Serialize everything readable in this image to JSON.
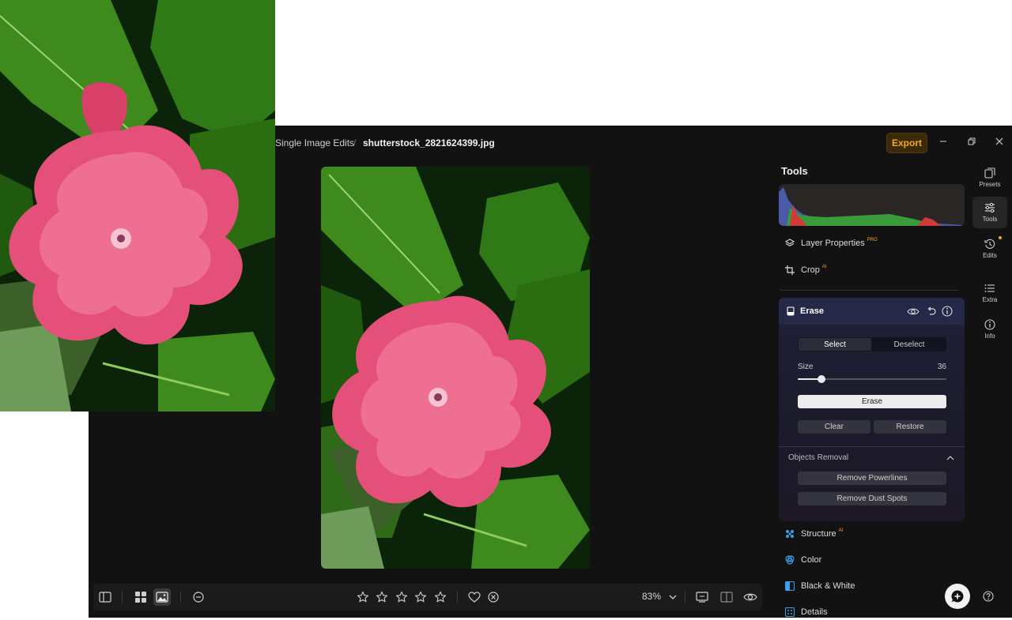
{
  "breadcrumb": {
    "root": "Single Image Edits",
    "separator": "/",
    "file": "shutterstock_2821624399.jpg"
  },
  "header": {
    "export_label": "Export"
  },
  "tools_panel": {
    "title": "Tools",
    "items": [
      {
        "label": "Layer Properties",
        "badge": "PRO",
        "icon": "layers-icon"
      },
      {
        "label": "Crop",
        "badge": "AI",
        "icon": "crop-icon"
      }
    ],
    "erase": {
      "title": "Erase",
      "select_label": "Select",
      "deselect_label": "Deselect",
      "size_label": "Size",
      "size_value": "36",
      "size_fraction": 0.16,
      "erase_label": "Erase",
      "clear_label": "Clear",
      "restore_label": "Restore",
      "objects_removal_title": "Objects Removal",
      "remove_powerlines_label": "Remove Powerlines",
      "remove_dust_label": "Remove Dust Spots"
    },
    "lower_items": [
      {
        "label": "Structure",
        "badge": "AI",
        "icon": "structure-icon"
      },
      {
        "label": "Color",
        "badge": "",
        "icon": "color-icon"
      },
      {
        "label": "Black & White",
        "badge": "",
        "icon": "black-white-icon"
      },
      {
        "label": "Details",
        "badge": "",
        "icon": "details-icon"
      }
    ]
  },
  "rail": [
    {
      "label": "Presets",
      "icon": "presets-icon"
    },
    {
      "label": "Tools",
      "icon": "sliders-icon"
    },
    {
      "label": "Edits",
      "icon": "history-icon"
    },
    {
      "label": "Extra",
      "icon": "list-icon"
    },
    {
      "label": "Info",
      "icon": "info-icon"
    }
  ],
  "bottombar": {
    "zoom": "83%",
    "rating_max": 5,
    "rating": 0
  },
  "colors": {
    "accent": "#f5a623",
    "panel": "#121212",
    "erase_panel": "#20213a"
  }
}
